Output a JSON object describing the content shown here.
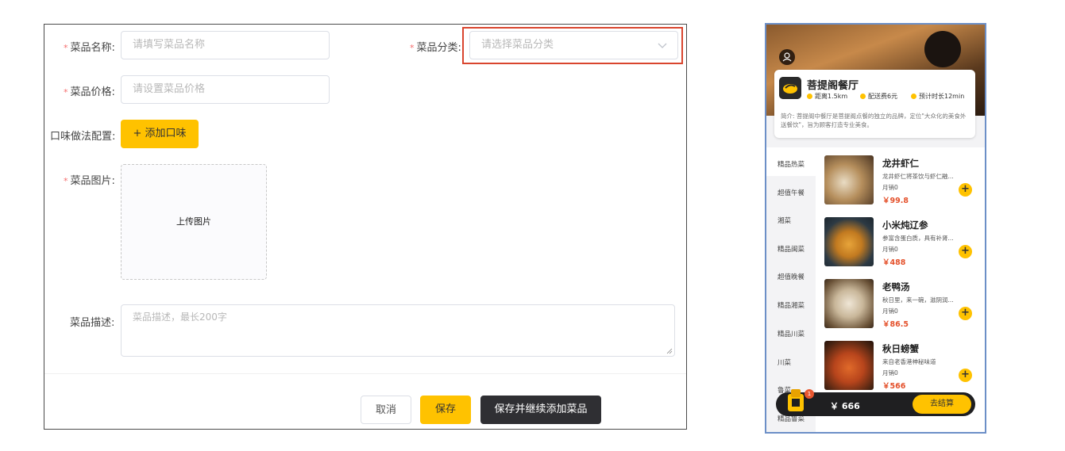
{
  "form": {
    "name_label": "菜品名称:",
    "name_placeholder": "请填写菜品名称",
    "category_label": "菜品分类:",
    "category_placeholder": "请选择菜品分类",
    "price_label": "菜品价格:",
    "price_placeholder": "请设置菜品价格",
    "taste_label": "口味做法配置:",
    "taste_button": "+ 添加口味",
    "image_label": "菜品图片:",
    "upload_text": "上传图片",
    "desc_label": "菜品描述:",
    "desc_placeholder": "菜品描述，最长200字",
    "required_mark": "*",
    "cancel": "取消",
    "save": "保存",
    "save_continue": "保存并继续添加菜品"
  },
  "phone": {
    "shop_name": "菩提阁餐厅",
    "distance": "距离1.5km",
    "delivery_fee": "配送费6元",
    "eta": "预计时长12min",
    "description": "简介: 菩提阁中餐厅是菩提阁点餐的独立的品牌，定位\"大众化的美食外送餐饮\"，旨为顾客打造专业美食。",
    "categories": [
      "精品热菜",
      "超值午餐",
      "湘菜",
      "精品闽菜",
      "超值晚餐",
      "精品湘菜",
      "精品川菜",
      "川菜",
      "鲁菜",
      "精品鲁菜"
    ],
    "dishes": [
      {
        "name": "龙井虾仁",
        "desc": "龙井虾仁将茶饮与虾仁融...",
        "sales": "月销0",
        "price": "￥99.8"
      },
      {
        "name": "小米炖辽参",
        "desc": "参富含蛋白质，具有补肾...",
        "sales": "月销0",
        "price": "￥488"
      },
      {
        "name": "老鸭汤",
        "desc": "秋日里，来一碗，滋阴润...",
        "sales": "月销0",
        "price": "￥86.5"
      },
      {
        "name": "秋日螃蟹",
        "desc": "来自老香港神秘味道",
        "sales": "月销0",
        "price": "￥566"
      }
    ],
    "add_symbol": "+",
    "cart_badge": "1",
    "cart_total": "￥ 666",
    "checkout": "去结算"
  }
}
